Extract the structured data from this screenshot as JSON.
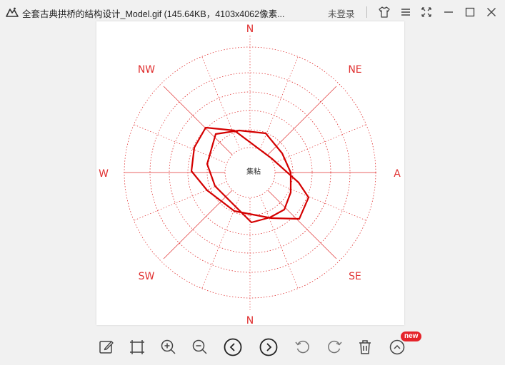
{
  "window": {
    "title": "全套古典拱桥的结构设计_Model.gif (145.64KB，4103x4062像素...",
    "login_label": "未登录",
    "controls": [
      "shirt-icon",
      "menu-icon",
      "fullscreen-icon",
      "minimize-icon",
      "maximize-icon",
      "close-icon"
    ]
  },
  "image_content": {
    "compass": {
      "north_top": "N",
      "north_bottom": "N",
      "west": "W",
      "east": "A",
      "nw": "NW",
      "ne": "NE",
      "sw": "SW",
      "se": "SE"
    },
    "center_label": "集粘"
  },
  "colors": {
    "accent_red": "#e5232a",
    "rose_red": "#d40000"
  },
  "toolbar": {
    "badge": "new",
    "buttons": [
      "edit-icon",
      "crop-icon",
      "zoom-in-icon",
      "zoom-out-icon",
      "prev-icon",
      "next-icon",
      "rotate-left-icon",
      "rotate-right-icon",
      "delete-icon",
      "expand-up-icon"
    ]
  }
}
